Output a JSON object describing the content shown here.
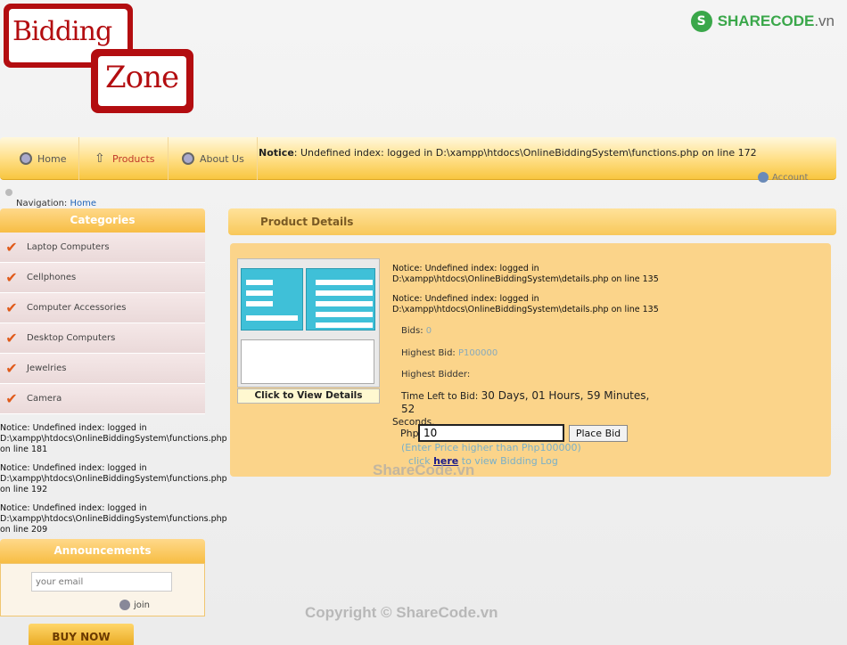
{
  "logo": {
    "line1": "Bidding",
    "line2": "Zone"
  },
  "watermark": {
    "brand_left": "SHARECODE",
    "brand_right": ".vn",
    "center": "ShareCode.vn",
    "copyright": "Copyright © ShareCode.vn"
  },
  "nav": {
    "items": [
      {
        "label": "Home",
        "icon": "home-icon"
      },
      {
        "label": "Products",
        "icon": "arrow-up-icon"
      },
      {
        "label": "About Us",
        "icon": "globe-icon"
      }
    ],
    "notice_prefix": "Notice",
    "notice_text": ": Undefined index: logged in D:\\xampp\\htdocs\\OnlineBiddingSystem\\functions.php on line 172",
    "account_label": "Account"
  },
  "breadcrumb": {
    "prefix": "Navigation:",
    "link": "Home"
  },
  "categories": {
    "title": "Categories",
    "items": [
      "Laptop Computers",
      "Cellphones",
      "Computer Accessories",
      "Desktop Computers",
      "Jewelries",
      "Camera"
    ]
  },
  "side_notices": [
    {
      "line1": "Notice: Undefined index: logged in",
      "line2": "D:\\xampp\\htdocs\\OnlineBiddingSystem\\functions.php",
      "line3": "on line 181"
    },
    {
      "line1": "Notice: Undefined index: logged in",
      "line2": "D:\\xampp\\htdocs\\OnlineBiddingSystem\\functions.php",
      "line3": "on line 192"
    },
    {
      "line1": "Notice: Undefined index: logged in",
      "line2": "D:\\xampp\\htdocs\\OnlineBiddingSystem\\functions.php",
      "line3": "on line 209"
    }
  ],
  "announcements": {
    "title": "Announcements",
    "email_placeholder": "your email",
    "join_label": "join",
    "buy_now": "BUY NOW"
  },
  "product": {
    "section_title": "Product Details",
    "thumbnail_caption": "Click to View Details",
    "notices": [
      {
        "line1": "Notice: Undefined index: logged in",
        "line2": "D:\\xampp\\htdocs\\OnlineBiddingSystem\\details.php on line 135"
      },
      {
        "line1": "Notice: Undefined index: logged in",
        "line2": "D:\\xampp\\htdocs\\OnlineBiddingSystem\\details.php on line 135"
      }
    ],
    "bids_label": "Bids:",
    "bids_value": "0",
    "highest_bid_label": "Highest Bid:",
    "highest_bid_value": "P100000",
    "highest_bidder_label": "Highest Bidder:",
    "time_left_label": "Time Left to Bid:",
    "time_left_value": "30 Days, 01 Hours, 59 Minutes, 52",
    "time_left_tail": "Seconds.",
    "currency_label": "Php",
    "bid_value": "10",
    "place_bid": "Place Bid",
    "hint": "(Enter Price higher than Php100000)",
    "log_prefix": "click",
    "log_link": "here",
    "log_suffix": "to view Bidding Log"
  }
}
